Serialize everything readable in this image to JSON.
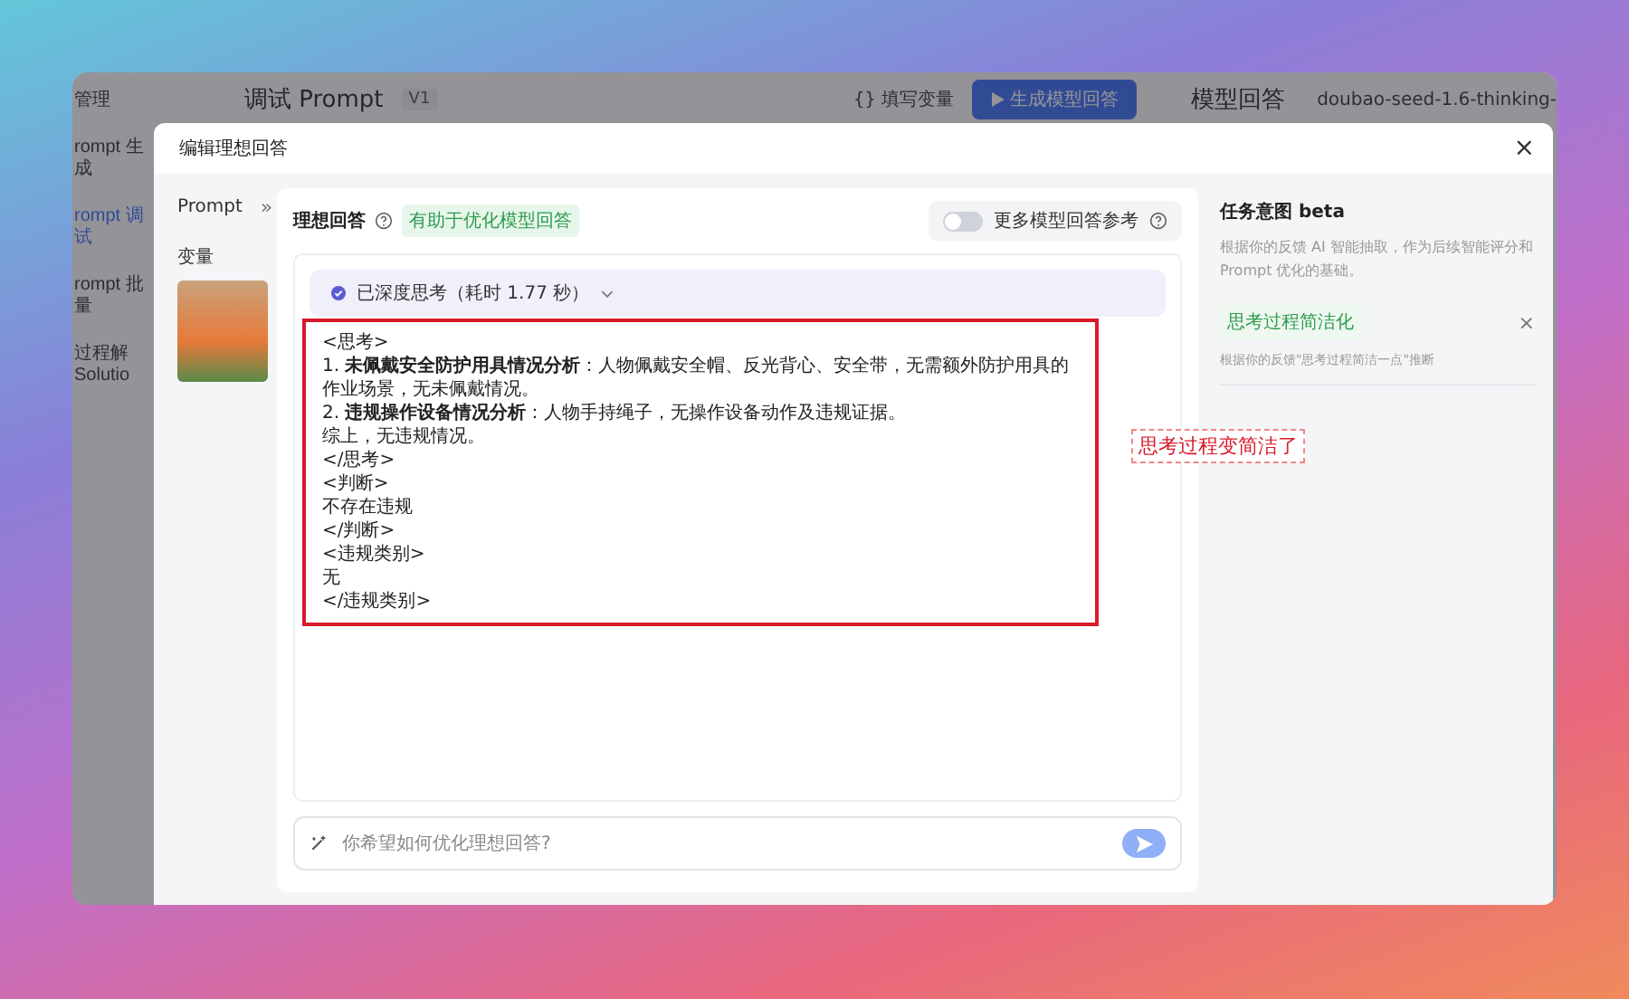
{
  "app": {
    "sidebar": {
      "items": [
        {
          "label": "管理",
          "selected": false
        },
        {
          "label": "rompt 生成",
          "selected": false
        },
        {
          "label": "rompt 调试",
          "selected": true
        },
        {
          "label": "rompt 批量",
          "selected": false
        },
        {
          "label": "过程解 Solutio",
          "selected": false
        }
      ]
    },
    "header": {
      "title": "调试 Prompt",
      "version": "V1",
      "fill_variables": "填写变量",
      "variables_glyph": "{}",
      "generate_button": "生成模型回答",
      "answer_title": "模型回答",
      "model": "doubao-seed-1.6-thinking-"
    }
  },
  "modal": {
    "title": "编辑理想回答",
    "close": "×",
    "left": {
      "prompt_label": "Prompt",
      "collapse_glyph": "»",
      "variables_label": "变量"
    },
    "answer": {
      "title": "理想回答",
      "tag": "有助于优化模型回答",
      "toggle": {
        "label": "更多模型回答参考",
        "on": false
      },
      "thinking": "已深度思考（耗时 1.77 秒）",
      "lines": [
        "<思考>",
        "1. **未佩戴安全防护用具情况分析**：人物佩戴安全帽、反光背心、安全带，无需额外防护用具的作业场景，无未佩戴情况。",
        "2. **违规操作设备情况分析**：人物手持绳子，无操作设备动作及违规证据。",
        "综上，无违规情况。",
        "</思考>",
        "<判断>",
        "不存在违规",
        "</判断>",
        "<违规类别>",
        "无",
        "</违规类别>"
      ],
      "annotation": "思考过程变简洁了",
      "input": {
        "placeholder": "你希望如何优化理想回答?"
      }
    },
    "intent": {
      "title": "任务意图 beta",
      "description": "根据你的反馈 AI 智能抽取，作为后续智能评分和 Prompt 优化的基础。",
      "items": [
        {
          "title": "思考过程简洁化",
          "note": "根据你的反馈\"思考过程简洁一点\"推断",
          "remove": "×"
        }
      ]
    }
  }
}
